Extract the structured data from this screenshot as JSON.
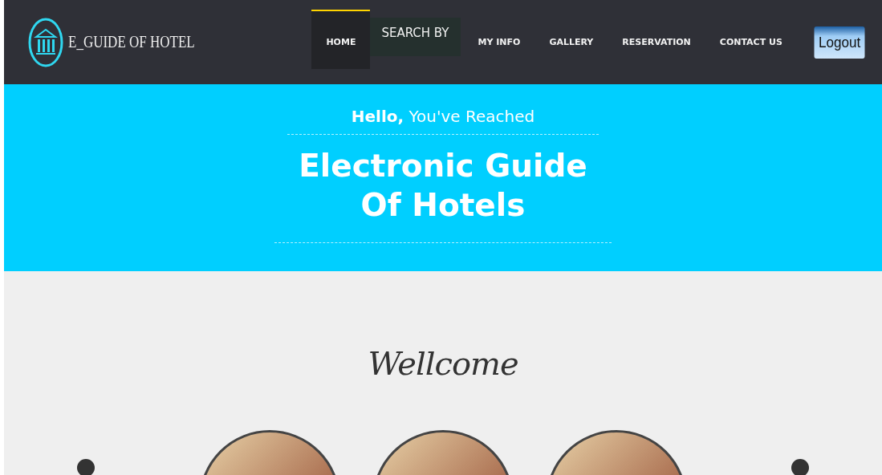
{
  "brand": {
    "name": "E_GUIDE OF HOTEL"
  },
  "nav": [
    {
      "label": "HOME",
      "kind": "link",
      "selected": true
    },
    {
      "label": "SEARCH BY",
      "kind": "dropdown",
      "selected": false
    },
    {
      "label": "MY INFO",
      "kind": "link",
      "selected": false
    },
    {
      "label": "GALLERY",
      "kind": "link",
      "selected": false
    },
    {
      "label": "RESERVATION",
      "kind": "link",
      "selected": false
    },
    {
      "label": "CONTACT US",
      "kind": "link",
      "selected": false
    }
  ],
  "logout": "Logout",
  "hero": {
    "greeting": "**Hello,** You've Reached",
    "title_lines": [
      "Electronic Guide",
      "Of Hotels"
    ]
  },
  "welcome": "Wellcome"
}
